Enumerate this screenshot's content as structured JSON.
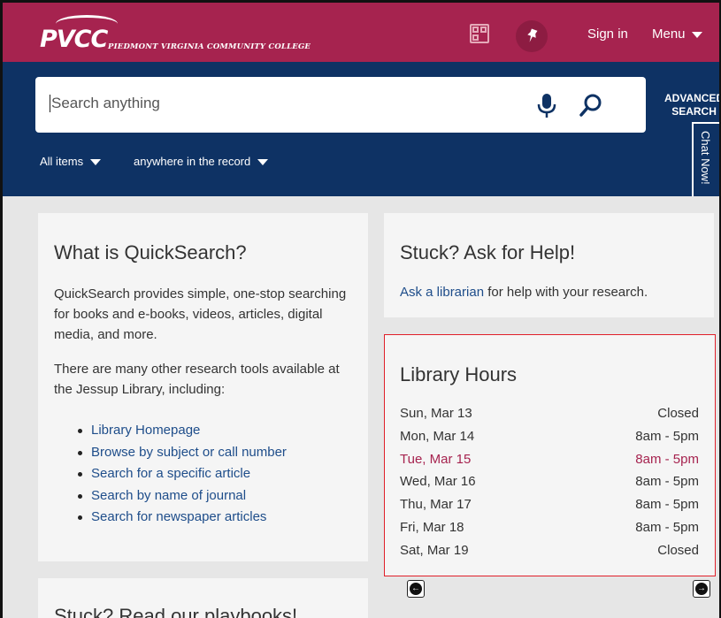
{
  "header": {
    "logo_main": "PVCC",
    "logo_sub": "PIEDMONT VIRGINIA COMMUNITY COLLEGE",
    "sign_in": "Sign in",
    "menu": "Menu"
  },
  "search": {
    "placeholder": "Search anything",
    "advanced_line1": "ADVANCED",
    "advanced_line2": "SEARCH",
    "scope": "All items",
    "field": "anywhere in the record"
  },
  "chat": {
    "label": "Chat Now!"
  },
  "what": {
    "title": "What is QuickSearch?",
    "p1": "QuickSearch provides simple, one-stop searching for books and e-books, videos, articles, digital media, and more.",
    "p2": "There are many other research tools available at the Jessup Library, including:",
    "links": [
      "Library Homepage",
      "Browse by subject or call number",
      "Search for a specific article",
      "Search by name of journal",
      "Search for newspaper articles"
    ]
  },
  "help": {
    "title": "Stuck? Ask for Help!",
    "link": "Ask a librarian",
    "rest": " for help with your research."
  },
  "hours": {
    "title": "Library Hours",
    "rows": [
      {
        "day": "Sun, Mar 13",
        "time": "Closed"
      },
      {
        "day": "Mon, Mar 14",
        "time": "8am - 5pm"
      },
      {
        "day": "Tue, Mar 15",
        "time": "8am - 5pm"
      },
      {
        "day": "Wed, Mar 16",
        "time": "8am - 5pm"
      },
      {
        "day": "Thu, Mar 17",
        "time": "8am - 5pm"
      },
      {
        "day": "Fri, Mar 18",
        "time": "8am - 5pm"
      },
      {
        "day": "Sat, Mar 19",
        "time": "Closed"
      }
    ],
    "today_index": 2
  },
  "playbooks": {
    "title": "Stuck? Read our playbooks!"
  },
  "colors": {
    "header_bg": "#a6234f",
    "search_band_bg": "#0e3264",
    "link": "#1e4d8a",
    "highlight_border": "#e0202a",
    "today_text": "#a6234f"
  },
  "icons": [
    "qr-code-icon",
    "pin-icon",
    "microphone-icon",
    "search-icon",
    "chevron-left-icon",
    "chevron-right-icon"
  ]
}
